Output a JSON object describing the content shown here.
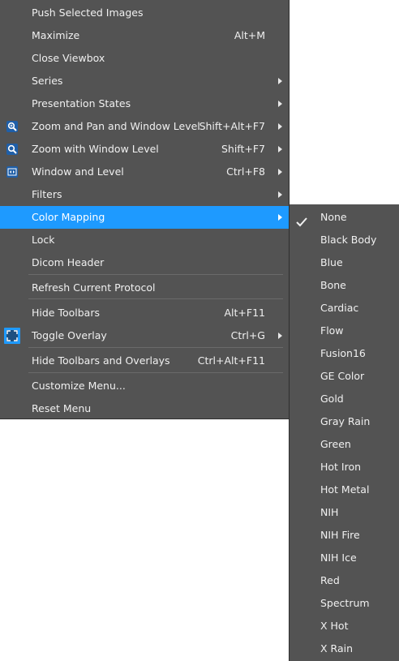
{
  "menu": {
    "items": [
      {
        "label": "Push Selected Images"
      },
      {
        "label": "Maximize",
        "shortcut": "Alt+M"
      },
      {
        "label": "Close Viewbox"
      },
      {
        "label": "Series"
      },
      {
        "label": "Presentation States"
      },
      {
        "label": "Zoom and Pan and Window Level",
        "shortcut": "Shift+Alt+F7",
        "icon": "zoom-pan-icon"
      },
      {
        "label": "Zoom with Window Level",
        "shortcut": "Shift+F7",
        "icon": "zoom-icon"
      },
      {
        "label": "Window and Level",
        "shortcut": "Ctrl+F8",
        "icon": "window-level-icon"
      },
      {
        "label": "Filters"
      },
      {
        "label": "Color Mapping"
      },
      {
        "label": "Lock"
      },
      {
        "label": "Dicom Header"
      },
      {
        "label": "Refresh Current Protocol"
      },
      {
        "label": "Hide Toolbars",
        "shortcut": "Alt+F11"
      },
      {
        "label": "Toggle Overlay",
        "shortcut": "Ctrl+G",
        "icon": "overlay-icon"
      },
      {
        "label": "Hide Toolbars and Overlays",
        "shortcut": "Ctrl+Alt+F11"
      },
      {
        "label": "Customize Menu..."
      },
      {
        "label": "Reset Menu"
      }
    ],
    "highlight_color": "#1e9aff",
    "background_color": "#535353"
  },
  "color_mapping_submenu": {
    "selected": "None",
    "options": [
      "None",
      "Black Body",
      "Blue",
      "Bone",
      "Cardiac",
      "Flow",
      "Fusion16",
      "GE Color",
      "Gold",
      "Gray Rain",
      "Green",
      "Hot Iron",
      "Hot Metal",
      "NIH",
      "NIH Fire",
      "NIH Ice",
      "Red",
      "Spectrum",
      "X Hot",
      "X Rain"
    ]
  }
}
